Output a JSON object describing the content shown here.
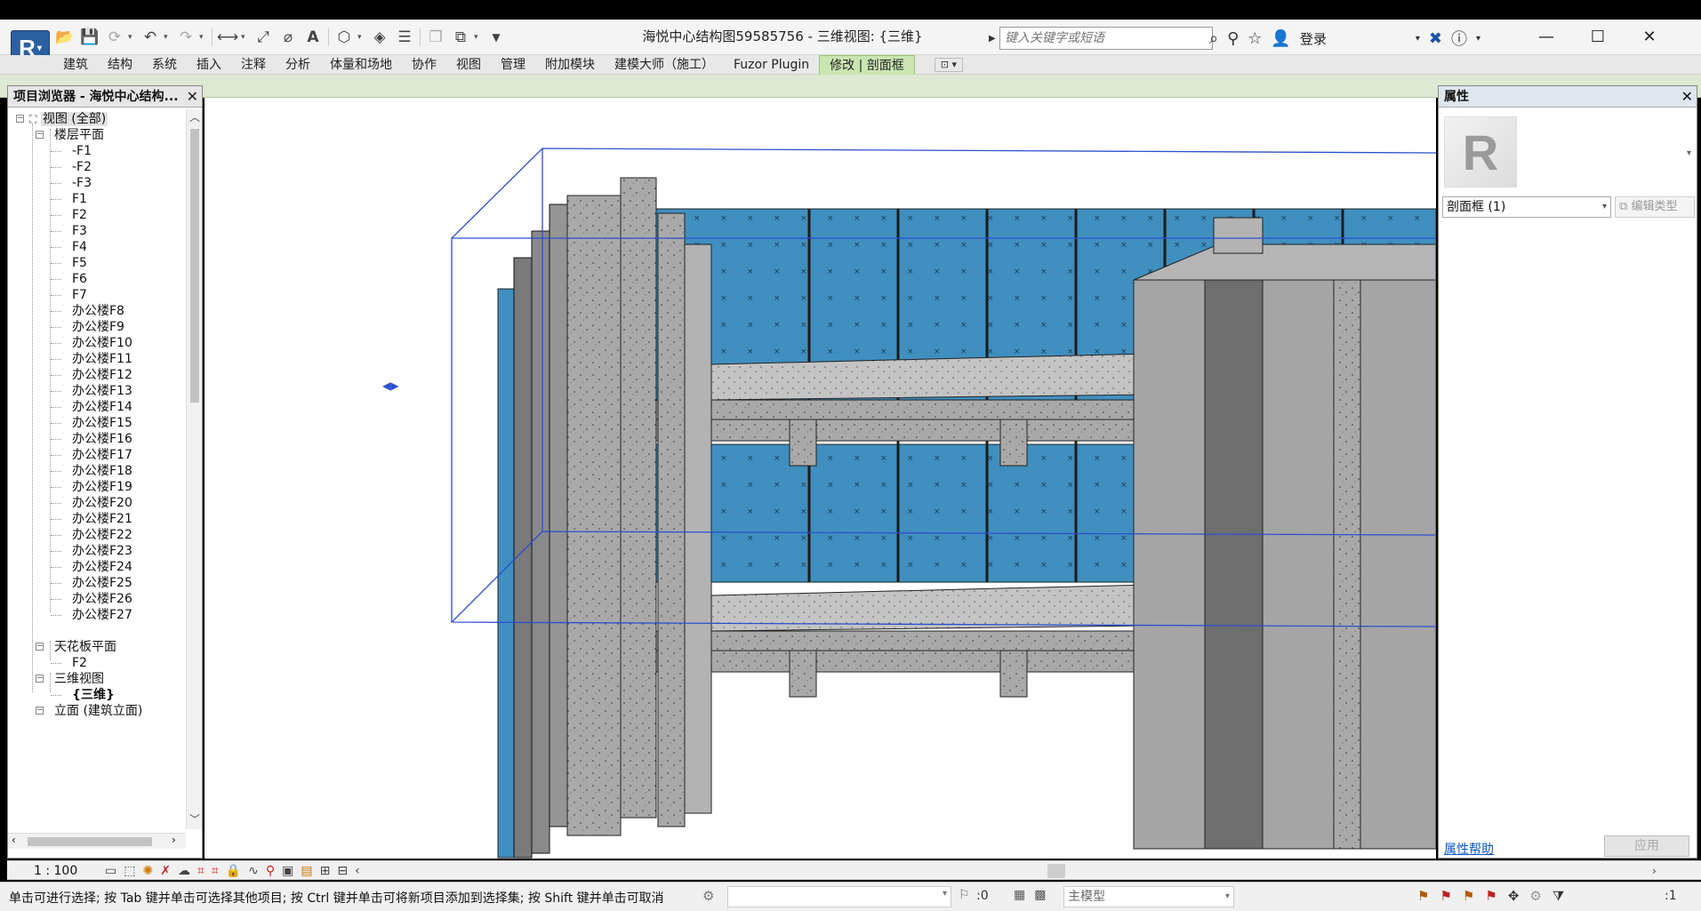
{
  "window": {
    "title": "海悦中心结构图59585756 - 三维视图: {三维}",
    "search_placeholder": "键入关键字或短语",
    "login": "登录",
    "controls": [
      "—",
      "☐",
      "✕"
    ]
  },
  "app_button": {
    "letter": "R"
  },
  "ribbon": {
    "tabs": [
      "建筑",
      "结构",
      "系统",
      "插入",
      "注释",
      "分析",
      "体量和场地",
      "协作",
      "视图",
      "管理",
      "附加模块",
      "建模大师（施工）",
      "Fuzor Plugin",
      "修改 | 剖面框"
    ],
    "active_tab": "修改 | 剖面框"
  },
  "browser": {
    "title": "项目浏览器 - 海悦中心结构...",
    "root": "视图 (全部)",
    "floor_plans": {
      "label": "楼层平面",
      "items": [
        "-F1",
        "-F2",
        "-F3",
        "F1",
        "F2",
        "F3",
        "F4",
        "F5",
        "F6",
        "F7",
        "办公楼F8",
        "办公楼F9",
        "办公楼F10",
        "办公楼F11",
        "办公楼F12",
        "办公楼F13",
        "办公楼F14",
        "办公楼F15",
        "办公楼F16",
        "办公楼F17",
        "办公楼F18",
        "办公楼F19",
        "办公楼F20",
        "办公楼F21",
        "办公楼F22",
        "办公楼F23",
        "办公楼F24",
        "办公楼F25",
        "办公楼F26",
        "办公楼F27"
      ]
    },
    "ceiling_plans": {
      "label": "天花板平面",
      "items": [
        "F2"
      ]
    },
    "views_3d": {
      "label": "三维视图",
      "items": [
        "{三维}"
      ]
    },
    "elevations": {
      "label": "立面 (建筑立面)"
    }
  },
  "properties": {
    "title": "属性",
    "type_name": "剖面框 (1)",
    "edit_type": "编辑类型",
    "help": "属性帮助",
    "apply": "应用"
  },
  "view_control": {
    "scale": "1 : 100"
  },
  "status": {
    "message": "单击可进行选择; 按 Tab 键并单击可选择其他项目; 按 Ctrl 键并单击可将新项目添加到选择集; 按 Shift 键并单击可取消",
    "selection_count": ":0",
    "model": "主模型",
    "filter_count": ":1"
  },
  "colors": {
    "curtain_blue": "#3f8fbf",
    "concrete": "#a8a8a8",
    "dark_concrete": "#6e6e6e",
    "section_box": "#2b4fcf",
    "active_tab": "#c9e6b2"
  }
}
